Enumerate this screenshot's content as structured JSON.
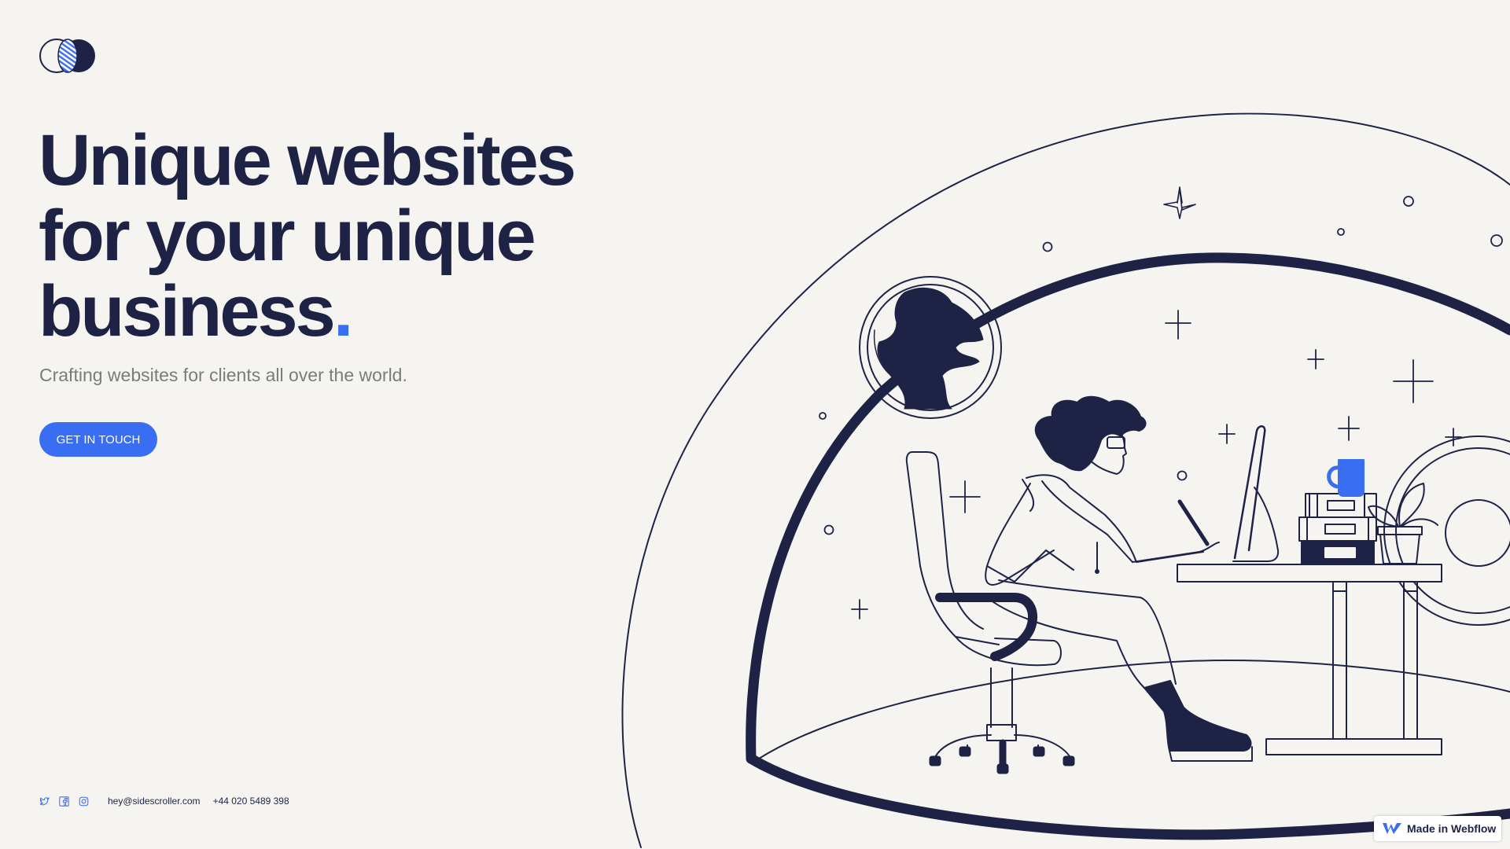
{
  "brand": {
    "logo_icon": "sidescroller-logo-icon",
    "accent_color": "#3a6ef2",
    "ink_color": "#1e2345"
  },
  "hero": {
    "headline_line1": "Unique websites",
    "headline_line2": "for your unique",
    "headline_line3": "business",
    "headline_dot": ".",
    "subheading": "Crafting websites for clients all over the world.",
    "cta_label": "GET IN TOUCH"
  },
  "footer": {
    "social_icons": [
      "twitter-icon",
      "facebook-icon",
      "instagram-icon"
    ],
    "email": "hey@sidescroller.com",
    "phone": "+44 020 5489 398"
  },
  "illustration": {
    "subject": "person-at-desk-in-dome-illustration"
  },
  "webflow_badge": {
    "label": "Made in Webflow"
  }
}
